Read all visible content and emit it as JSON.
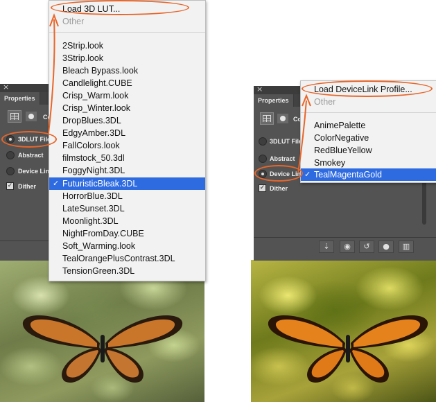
{
  "left": {
    "panel": {
      "close": "×",
      "tab": "Properties",
      "header_text": "Co",
      "options": [
        {
          "label": "3DLUT File",
          "selected": true
        },
        {
          "label": "Abstract",
          "selected": false
        },
        {
          "label": "Device Link",
          "selected": false
        }
      ],
      "dither_label": "Dither",
      "dither_checked": true
    },
    "menu": {
      "top_item": "Load 3D LUT...",
      "other_item": "Other",
      "items": [
        "2Strip.look",
        "3Strip.look",
        "Bleach Bypass.look",
        "Candlelight.CUBE",
        "Crisp_Warm.look",
        "Crisp_Winter.look",
        "DropBlues.3DL",
        "EdgyAmber.3DL",
        "FallColors.look",
        "filmstock_50.3dl",
        "FoggyNight.3DL",
        "FuturisticBleak.3DL",
        "HorrorBlue.3DL",
        "LateSunset.3DL",
        "Moonlight.3DL",
        "NightFromDay.CUBE",
        "Soft_Warming.look",
        "TealOrangePlusContrast.3DL",
        "TensionGreen.3DL"
      ],
      "selected_item": "FuturisticBleak.3DL",
      "check_glyph": "✓"
    }
  },
  "right": {
    "panel": {
      "close": "×",
      "tab": "Properties",
      "header_text": "Co",
      "options": [
        {
          "label": "3DLUT File",
          "selected": false
        },
        {
          "label": "Abstract",
          "selected": false
        },
        {
          "label": "Device Link",
          "selected": true
        }
      ],
      "dither_label": "Dither",
      "dither_checked": true,
      "bottom_buttons": [
        "clip-to-layer-icon",
        "visibility-toggle-icon",
        "reset-icon",
        "eye-icon",
        "trash-icon"
      ]
    },
    "menu": {
      "top_item": "Load DeviceLink Profile...",
      "other_item": "Other",
      "items": [
        "AnimePalette",
        "ColorNegative",
        "RedBlueYellow",
        "Smokey",
        "TealMagentaGold"
      ],
      "selected_item": "TealMagentaGold",
      "check_glyph": "✓"
    }
  },
  "colors": {
    "annotation": "#e8662a",
    "highlight": "#2f6be0",
    "panel_bg": "#535353",
    "menu_bg": "#f2f2f2"
  }
}
